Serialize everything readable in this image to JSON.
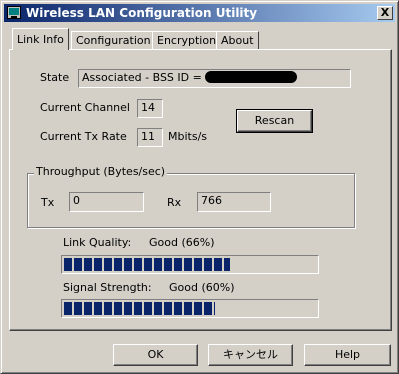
{
  "window": {
    "title": "Wireless LAN Configuration Utility",
    "close_glyph": "X"
  },
  "tabs": [
    {
      "label": "Link Info",
      "active": true
    },
    {
      "label": "Configuration",
      "active": false
    },
    {
      "label": "Encryption",
      "active": false
    },
    {
      "label": "About",
      "active": false
    }
  ],
  "link_info": {
    "state_label": "State",
    "state_value": "Associated - BSS ID =",
    "channel_label": "Current Channel",
    "channel_value": "14",
    "tx_rate_label": "Current Tx Rate",
    "tx_rate_value": "11",
    "tx_rate_unit": "Mbits/s",
    "rescan_label": "Rescan"
  },
  "throughput": {
    "title": "Throughput (Bytes/sec)",
    "tx_label": "Tx",
    "tx_value": "0",
    "rx_label": "Rx",
    "rx_value": "766"
  },
  "link_quality": {
    "label": "Link Quality:",
    "status": "Good (66%)",
    "percent": 66
  },
  "signal_strength": {
    "label": "Signal Strength:",
    "status": "Good (60%)",
    "percent": 60
  },
  "footer": {
    "ok_label": "OK",
    "cancel_label": "キャンセル",
    "help_label": "Help"
  },
  "colors": {
    "titlebar_start": "#0a246a",
    "titlebar_end": "#a6caf0",
    "face": "#d4d0c8",
    "progress_fill": "#0a246a"
  }
}
